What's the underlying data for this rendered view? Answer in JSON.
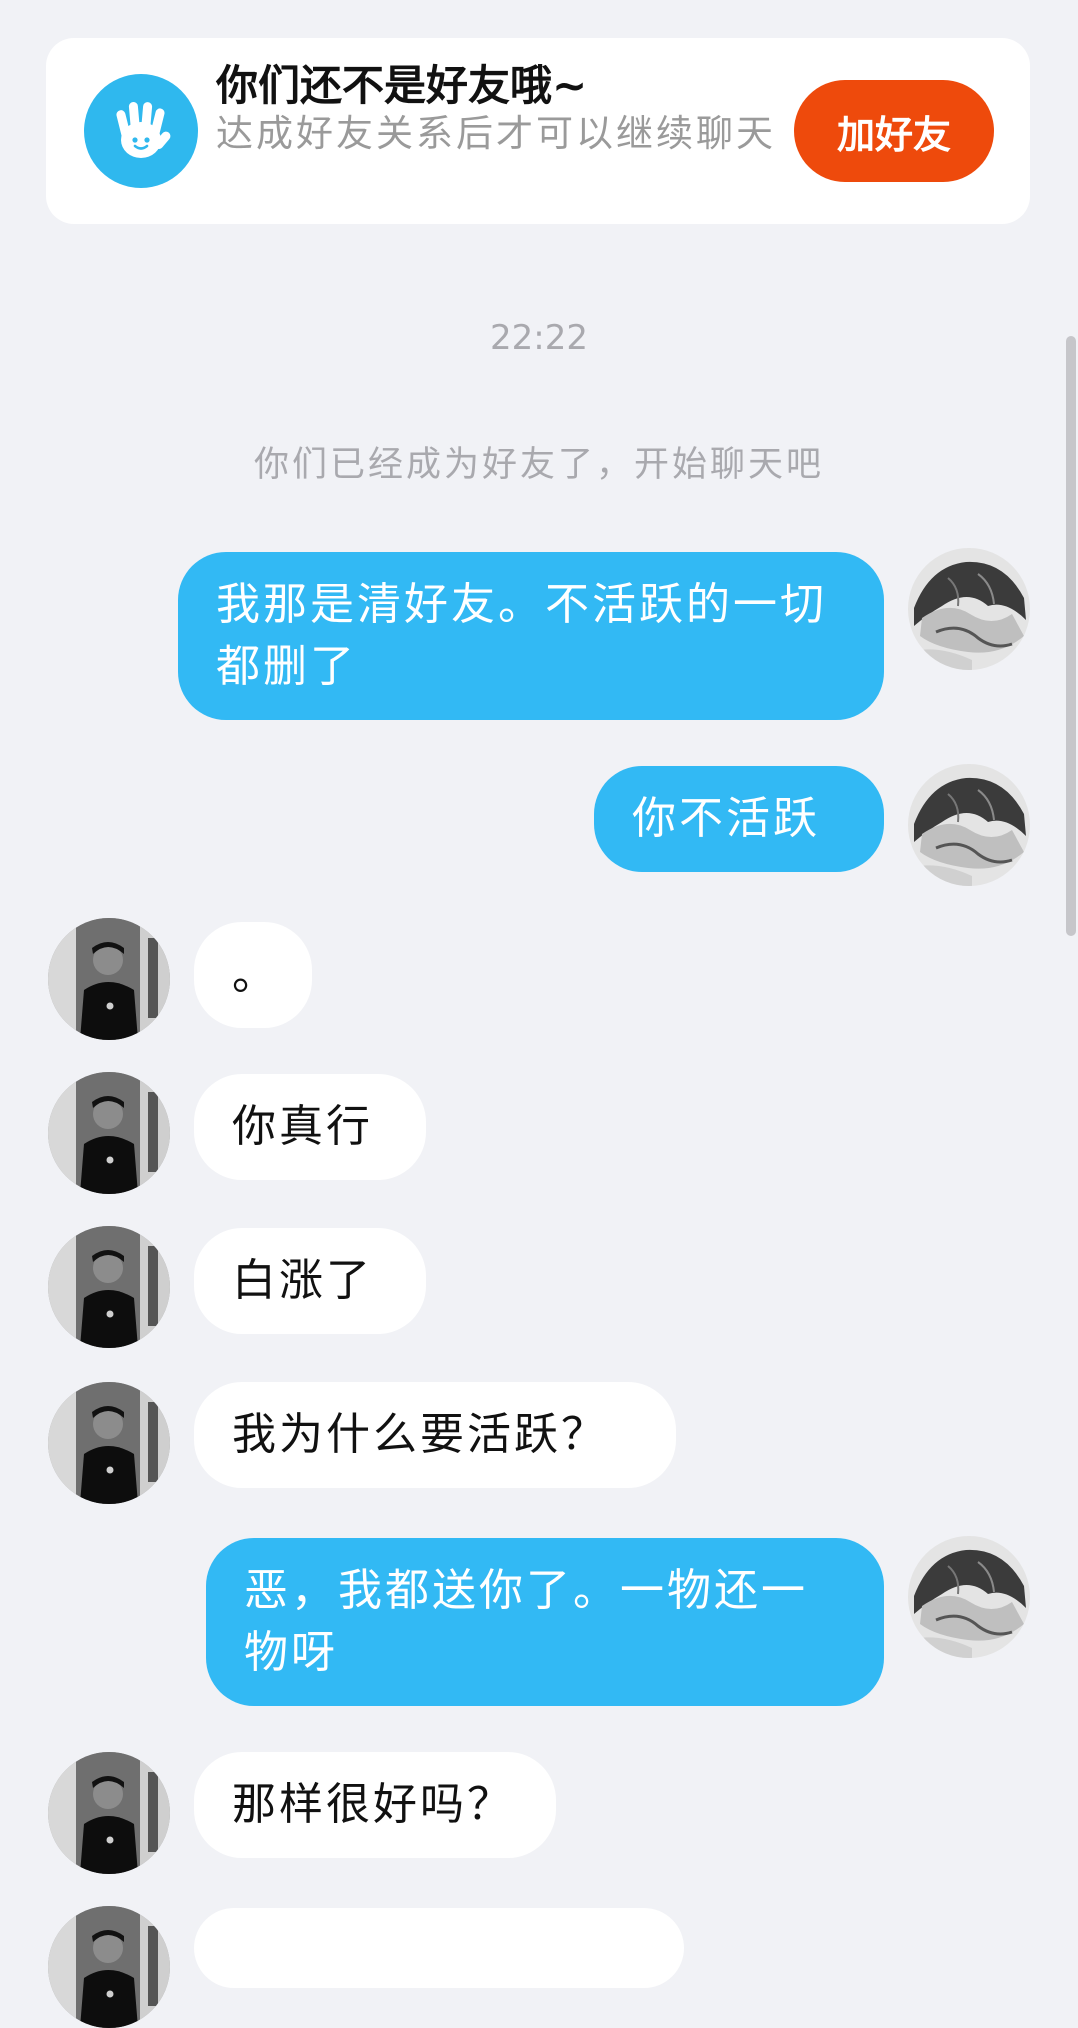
{
  "banner": {
    "title": "你们还不是好友哦~",
    "description": "达成好友关系后才可以继续聊天",
    "add_friend_label": "加好友",
    "icon": "waving-hand-icon",
    "accent": "#2fb8ee",
    "button_color": "#ee4a0c"
  },
  "chat": {
    "timestamp": "22:22",
    "system_message": "你们已经成为好友了，开始聊天吧",
    "outgoing_color": "#32b9f4",
    "incoming_color": "#ffffff",
    "messages": [
      {
        "direction": "out",
        "text": "我那是清好友。不活跃的一切都删了"
      },
      {
        "direction": "out",
        "text": "你不活跃"
      },
      {
        "direction": "in",
        "text": "。"
      },
      {
        "direction": "in",
        "text": "你真行"
      },
      {
        "direction": "in",
        "text": "白涨了"
      },
      {
        "direction": "in",
        "text": "我为什么要活跃？"
      },
      {
        "direction": "out",
        "text": "恶，我都送你了。一物还一物呀"
      },
      {
        "direction": "in",
        "text": "那样很好吗？"
      }
    ]
  }
}
